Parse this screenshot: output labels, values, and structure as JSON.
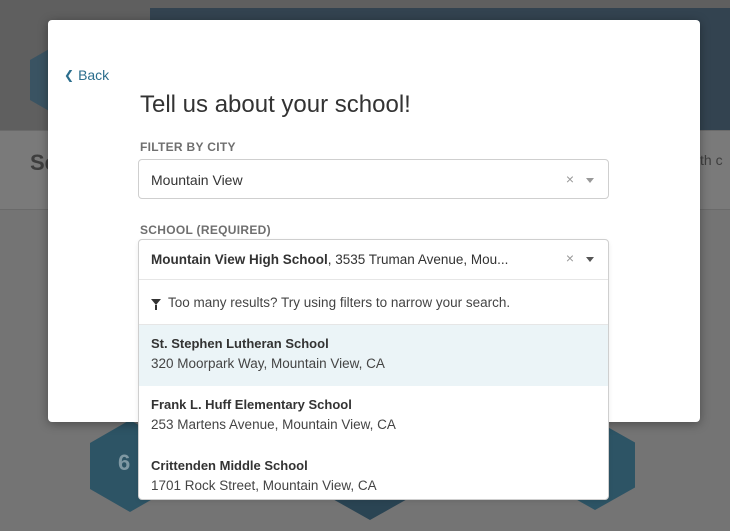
{
  "background": {
    "section_text": "Se",
    "side_text": "th c",
    "hex_badge_number": "6"
  },
  "modal": {
    "back_label": "Back",
    "title": "Tell us about your school!",
    "city_label": "FILTER BY CITY",
    "city_value": "Mountain View",
    "school_label": "SCHOOL (REQUIRED)",
    "school_value_bold": "Mountain View High School",
    "school_value_rest": ", 3535 Truman Avenue, Mou...",
    "clear_glyph": "×",
    "hint": "Too many results? Try using filters to narrow your search.",
    "options": [
      {
        "name": "St. Stephen Lutheran School",
        "address": "320 Moorpark Way, Mountain View, CA"
      },
      {
        "name": "Frank L. Huff Elementary School",
        "address": "253 Martens Avenue, Mountain View, CA"
      },
      {
        "name": "Crittenden Middle School",
        "address": "1701 Rock Street, Mountain View, CA"
      }
    ]
  },
  "colors": {
    "accent_link": "#2b6e8d",
    "active_option_bg": "#ebf4f7",
    "overlay": "#747474"
  }
}
